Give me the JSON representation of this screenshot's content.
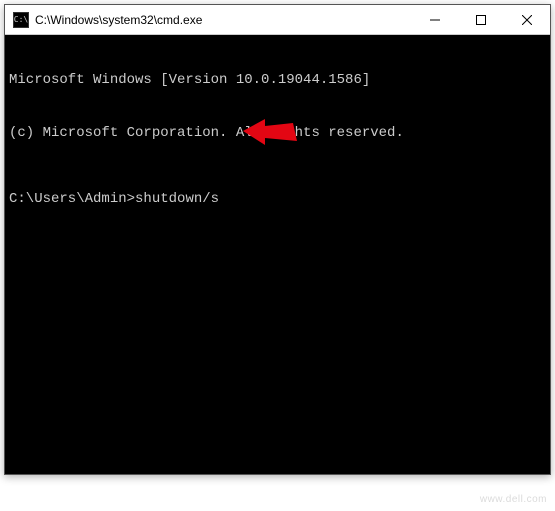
{
  "window": {
    "title": "C:\\Windows\\system32\\cmd.exe",
    "icon_glyph": "C:\\"
  },
  "controls": {
    "minimize": "Minimize",
    "maximize": "Maximize",
    "close": "Close"
  },
  "terminal": {
    "line1": "Microsoft Windows [Version 10.0.19044.1586]",
    "line2": "(c) Microsoft Corporation. All rights reserved.",
    "prompt": "C:\\Users\\Admin>",
    "command": "shutdown/s"
  },
  "annotation": {
    "arrow_color": "#e30613"
  },
  "watermark": "www.dell.com"
}
